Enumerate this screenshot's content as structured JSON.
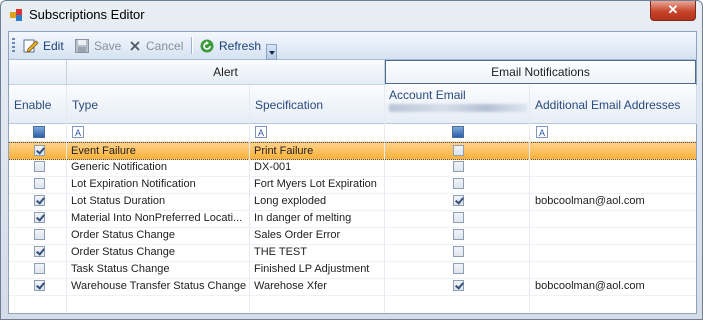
{
  "window": {
    "title": "Subscriptions Editor",
    "close_glyph": "✕"
  },
  "toolbar": {
    "edit": "Edit",
    "save": "Save",
    "cancel": "Cancel",
    "refresh": "Refresh"
  },
  "grid": {
    "bands": {
      "alert": "Alert",
      "email": "Email Notifications"
    },
    "columns": {
      "enable": "Enable",
      "type": "Type",
      "specification": "Specification",
      "account_email": "Account Email",
      "additional": "Additional Email Addresses"
    },
    "rows": [
      {
        "enabled": true,
        "type": "Event Failure",
        "spec": "Print Failure",
        "account": false,
        "additional": "",
        "selected": true
      },
      {
        "enabled": false,
        "type": "Generic Notification",
        "spec": "DX-001",
        "account": false,
        "additional": ""
      },
      {
        "enabled": false,
        "type": "Lot Expiration Notification",
        "spec": "Fort Myers Lot Expiration",
        "account": false,
        "additional": ""
      },
      {
        "enabled": true,
        "type": "Lot Status Duration",
        "spec": "Long exploded",
        "account": true,
        "additional": "bobcoolman@aol.com"
      },
      {
        "enabled": true,
        "type": "Material Into NonPreferred Locati...",
        "spec": "In danger of melting",
        "account": false,
        "additional": ""
      },
      {
        "enabled": false,
        "type": "Order Status Change",
        "spec": "Sales Order Error",
        "account": false,
        "additional": ""
      },
      {
        "enabled": true,
        "type": "Order Status Change",
        "spec": "THE TEST",
        "account": false,
        "additional": ""
      },
      {
        "enabled": false,
        "type": "Task Status Change",
        "spec": "Finished LP Adjustment",
        "account": false,
        "additional": ""
      },
      {
        "enabled": true,
        "type": "Warehouse Transfer Status Change",
        "spec": "Warehose Xfer",
        "account": true,
        "additional": "bobcoolman@aol.com"
      }
    ]
  }
}
